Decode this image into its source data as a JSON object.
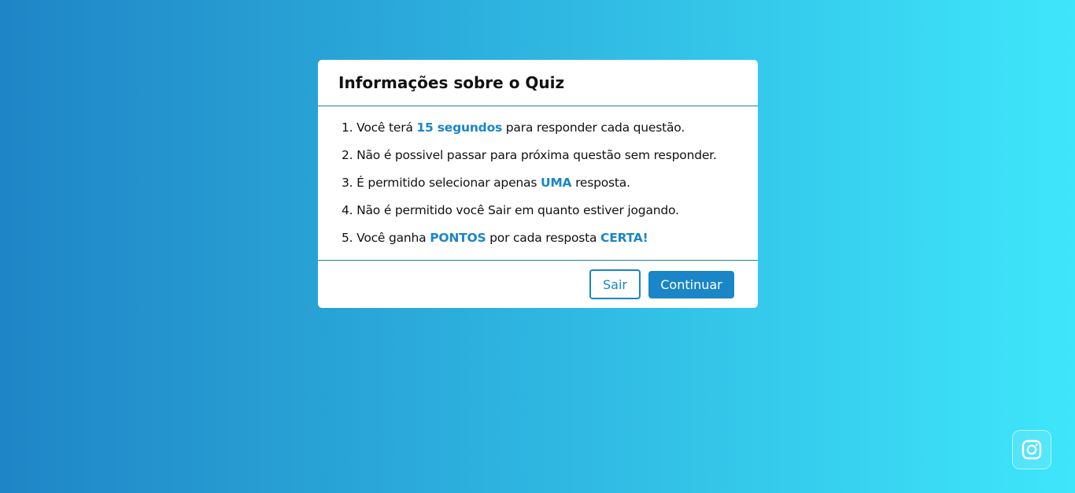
{
  "theme": {
    "gradient_start": "#1f85c6",
    "gradient_end": "#3ee6fb",
    "accent": "#1a86c7"
  },
  "info_box": {
    "title": "Informações sobre o Quiz",
    "rules": [
      {
        "parts": [
          {
            "t": "1. Você terá "
          },
          {
            "t": "15 segundos",
            "hl": true
          },
          {
            "t": " para responder cada questão."
          }
        ]
      },
      {
        "parts": [
          {
            "t": "2. Não é possivel passar para próxima questão sem responder."
          }
        ]
      },
      {
        "parts": [
          {
            "t": "3. É permitido selecionar apenas "
          },
          {
            "t": "UMA",
            "hl": true
          },
          {
            "t": " resposta."
          }
        ]
      },
      {
        "parts": [
          {
            "t": "4. Não é permitido você Sair em quanto estiver jogando."
          }
        ]
      },
      {
        "parts": [
          {
            "t": "5. Você ganha "
          },
          {
            "t": "PONTOS",
            "hl": true
          },
          {
            "t": " por cada resposta "
          },
          {
            "t": "CERTA!",
            "hl": true
          }
        ]
      }
    ],
    "buttons": {
      "quit_label": "Sair",
      "continue_label": "Continuar"
    }
  },
  "social": {
    "icon": "instagram-icon"
  }
}
